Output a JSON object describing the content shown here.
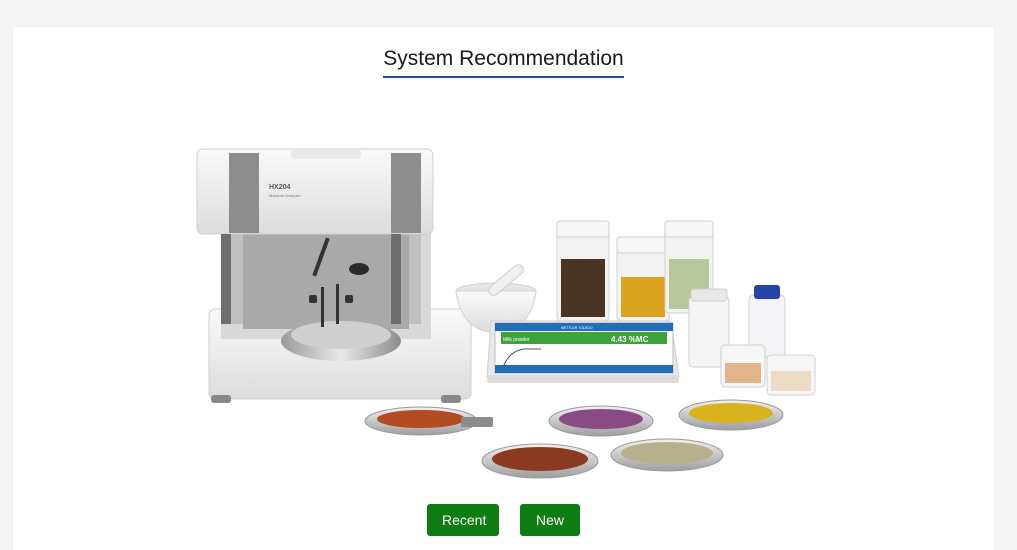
{
  "page": {
    "title": "System Recommendation"
  },
  "illustration": {
    "analyzer_model": "HX204",
    "analyzer_subtitle": "Moisture Analyzer",
    "display_brand": "METTLER TOLEDO",
    "display_method": "Milk powder",
    "display_reading": "4.43 %MC"
  },
  "actions": {
    "recent_label": "Recent",
    "new_label": "New"
  },
  "colors": {
    "button": "#0f7d12",
    "title_underline": "#1f4e8c",
    "screen_header": "#1f6fb8",
    "screen_result": "#3da33a"
  }
}
